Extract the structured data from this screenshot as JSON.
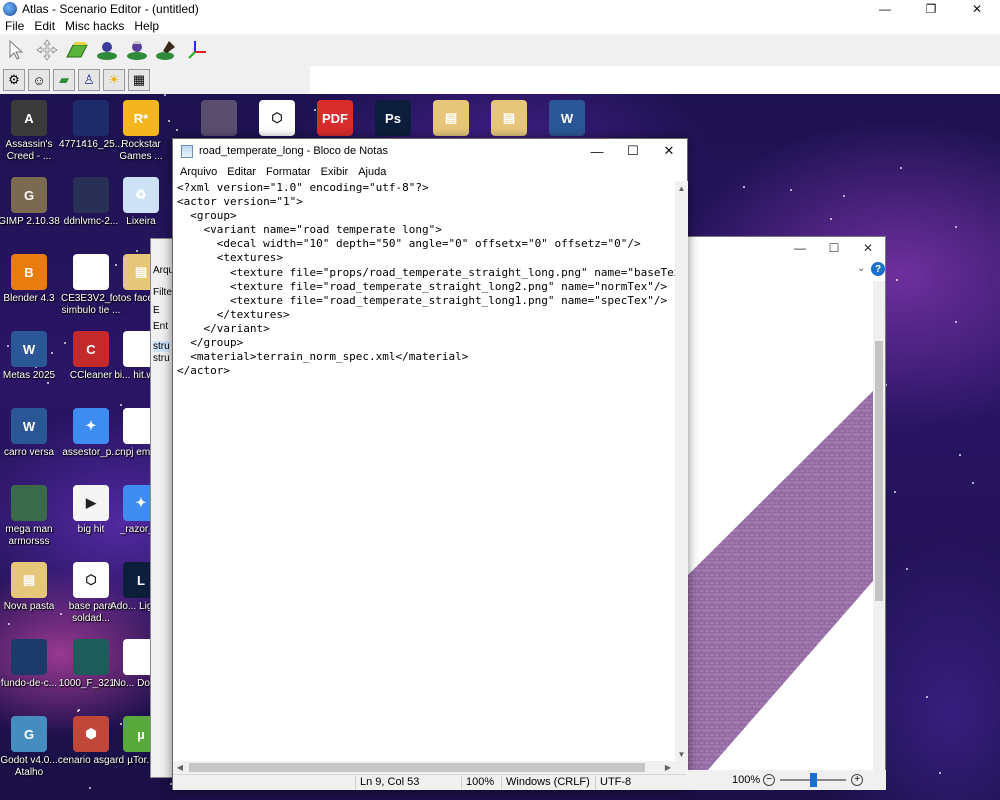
{
  "atlas": {
    "title": "Atlas - Scenario Editor - (untitled)",
    "window_controls": {
      "minimize": "—",
      "maximize": "❐",
      "close": "✕"
    },
    "menu": [
      "File",
      "Edit",
      "Misc hacks",
      "Help"
    ],
    "toolbar1_icons": [
      "select-arrow-icon",
      "move-icon",
      "terrain-paint-icon",
      "unit-place-icon",
      "actor-tool-icon",
      "brush-icon",
      "axis-gizmo-icon"
    ],
    "toolbar2_icons": [
      "gear-icon",
      "person-icon",
      "map-icon",
      "player-icon",
      "sun-icon",
      "clapper-icon"
    ]
  },
  "desktop": {
    "icons": [
      {
        "label": "Assassin's Creed - ...",
        "color": "#3a3a3a",
        "glyph": "A"
      },
      {
        "label": "4771416_25...",
        "color": "#1d2b6a",
        "glyph": ""
      },
      {
        "label": "Rockstar Games ...",
        "color": "#f3b61f",
        "glyph": "R*"
      },
      {
        "label": "",
        "color": "#5a4e6e",
        "glyph": ""
      },
      {
        "label": "",
        "color": "#ffffff",
        "glyph": "⬡"
      },
      {
        "label": "",
        "color": "#d92c2c",
        "glyph": "PDF"
      },
      {
        "label": "",
        "color": "#0c1e3c",
        "glyph": "Ps"
      },
      {
        "label": "",
        "color": "#e6c77a",
        "glyph": "▤"
      },
      {
        "label": "",
        "color": "#e6c77a",
        "glyph": "▤"
      },
      {
        "label": "",
        "color": "#2b5797",
        "glyph": "W"
      },
      {
        "label": "GIMP 2.10.38",
        "color": "#7a6a52",
        "glyph": "G"
      },
      {
        "label": "ddnlvmc-2...",
        "color": "#2a2f55",
        "glyph": ""
      },
      {
        "label": "Lixeira",
        "color": "#cde3f5",
        "glyph": "♻"
      },
      {
        "label": "Blender 4.3",
        "color": "#e87d0d",
        "glyph": "B"
      },
      {
        "label": "CE3E3V2_i... simbulo tie ...",
        "color": "#ffffff",
        "glyph": ""
      },
      {
        "label": "fotos facebo...",
        "color": "#e6c77a",
        "glyph": "▤"
      },
      {
        "label": "Metas 2025",
        "color": "#2b5797",
        "glyph": "W"
      },
      {
        "label": "CCleaner",
        "color": "#c52a2a",
        "glyph": "C"
      },
      {
        "label": "bi... hit.wa...",
        "color": "#ffffff",
        "glyph": ""
      },
      {
        "label": "carro versa",
        "color": "#2b5797",
        "glyph": "W"
      },
      {
        "label": "assestor_p...",
        "color": "#3f8cf0",
        "glyph": "✦"
      },
      {
        "label": "cnpj empr...",
        "color": "#ffffff",
        "glyph": ""
      },
      {
        "label": "mega man armorsss",
        "color": "#3a6a4a",
        "glyph": ""
      },
      {
        "label": "big hit",
        "color": "#f5f5f5",
        "glyph": "▶"
      },
      {
        "label": "_razor_...",
        "color": "#3f8cf0",
        "glyph": "✦"
      },
      {
        "label": "Nova pasta",
        "color": "#e6c77a",
        "glyph": "▤"
      },
      {
        "label": "base para soldad...",
        "color": "#ffffff",
        "glyph": "⬡"
      },
      {
        "label": "Ado... Lightr...",
        "color": "#0c1e3c",
        "glyph": "L"
      },
      {
        "label": "fundo-de-c...",
        "color": "#1d3b6a",
        "glyph": ""
      },
      {
        "label": "1000_F_321...",
        "color": "#1e5b5b",
        "glyph": ""
      },
      {
        "label": "No... Docu...",
        "color": "#ffffff",
        "glyph": ""
      },
      {
        "label": "Godot v4.0... Atalho",
        "color": "#478cbf",
        "glyph": "G"
      },
      {
        "label": "cenario asgard",
        "color": "#c0473a",
        "glyph": "⬢"
      },
      {
        "label": "µTor...",
        "color": "#59a83b",
        "glyph": "µ"
      }
    ]
  },
  "bg_window": {
    "fragments": [
      "Arqu",
      "Filte",
      "E",
      "Ent",
      "stru",
      "stru"
    ]
  },
  "viewer": {
    "controls": {
      "minimize": "—",
      "maximize": "☐",
      "close": "✕"
    },
    "help": "?",
    "expand": "⌄",
    "zoom": "100%",
    "zoom_out": "−",
    "zoom_in": "+"
  },
  "notepad": {
    "title": "road_temperate_long - Bloco de Notas",
    "controls": {
      "minimize": "—",
      "maximize": "☐",
      "close": "✕"
    },
    "menu": [
      "Arquivo",
      "Editar",
      "Formatar",
      "Exibir",
      "Ajuda"
    ],
    "lines": [
      "<?xml version=\"1.0\" encoding=\"utf-8\"?>",
      "<actor version=\"1\">",
      "  <group>",
      "    <variant name=\"road temperate long\">",
      "      <decal width=\"10\" depth=\"50\" angle=\"0\" offsetx=\"0\" offsetz=\"0\"/>",
      "      <textures>",
      "        <texture file=\"props/road_temperate_straight_long.png\" name=\"baseTex\"/>",
      "        <texture file=\"road_temperate_straight_long2.png\" name=\"normTex\"/>",
      "        <texture file=\"road_temperate_straight_long1.png\" name=\"specTex\"/>",
      "      </textures>",
      "    </variant>",
      "  </group>",
      "  <material>terrain_norm_spec.xml</material>",
      "</actor>"
    ],
    "status": {
      "position": "Ln 9, Col 53",
      "zoom": "100%",
      "line_ending": "Windows (CRLF)",
      "encoding": "UTF-8"
    }
  },
  "colors": {
    "road_texture": "#a178b0",
    "accent_blue": "#1a6fd1"
  }
}
